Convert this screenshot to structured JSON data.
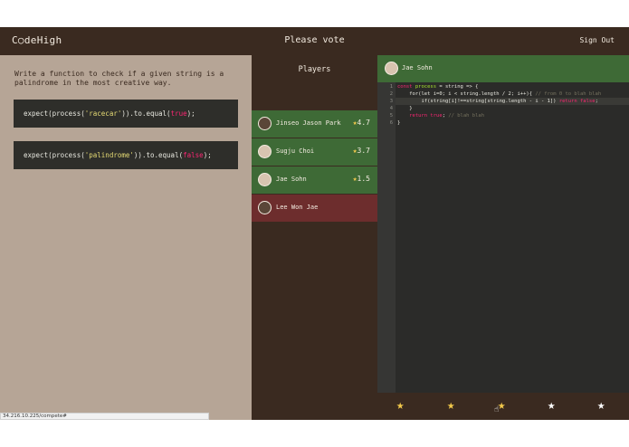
{
  "app": {
    "logo": "C○deHigh",
    "title": "Please vote",
    "signout": "Sign Out"
  },
  "challenge": {
    "prompt": "Write a function to check if a given string is a palindrome in the most creative way.",
    "tests": [
      {
        "prefix": "expect(process(",
        "arg": "'racecar'",
        "mid": ")).to.equal(",
        "expected": "true",
        "suffix": ");"
      },
      {
        "prefix": "expect(process(",
        "arg": "'palindrome'",
        "mid": ")).to.equal(",
        "expected": "false",
        "suffix": ");"
      }
    ]
  },
  "players": {
    "title": "Players",
    "list": [
      {
        "name": "Jinseo Jason Park",
        "rating": "4.7",
        "status": "green"
      },
      {
        "name": "Sugju Choi",
        "rating": "3.7",
        "status": "green"
      },
      {
        "name": "Jae Sohn",
        "rating": "1.5",
        "status": "green"
      },
      {
        "name": "Lee Won Jae",
        "rating": "",
        "status": "red"
      }
    ]
  },
  "editor": {
    "author": "Jae Sohn",
    "line_numbers": [
      "1",
      "2",
      "3",
      "4",
      "5",
      "6"
    ],
    "code": {
      "l1_a": "const ",
      "l1_b": "process",
      "l1_c": " = string => {",
      "l2_a": "    for(let i=0; i < string.length / 2; i++){ ",
      "l2_b": "// from 0 to blah blah",
      "l3_a": "        if(string[i]!==string[string.length - i - 1]) ",
      "l3_b": "return false",
      "l3_c": ";",
      "l4": "    }",
      "l5_a": "    ",
      "l5_b": "return true",
      "l5_c": "; ",
      "l5_d": "// blah blah",
      "l6": "}"
    }
  },
  "vote": {
    "stars": [
      "★",
      "★",
      "★",
      "★",
      "★"
    ],
    "selected": 3,
    "cursor": "☝"
  },
  "statusbar": {
    "url": "34.216.10.225/compete#"
  },
  "colors": {
    "topbar": "#3a2a20",
    "left_panel": "#b6a596",
    "player_active": "#3e6a36",
    "player_inactive": "#6d2d2d",
    "star_gold": "#f2c94c"
  }
}
